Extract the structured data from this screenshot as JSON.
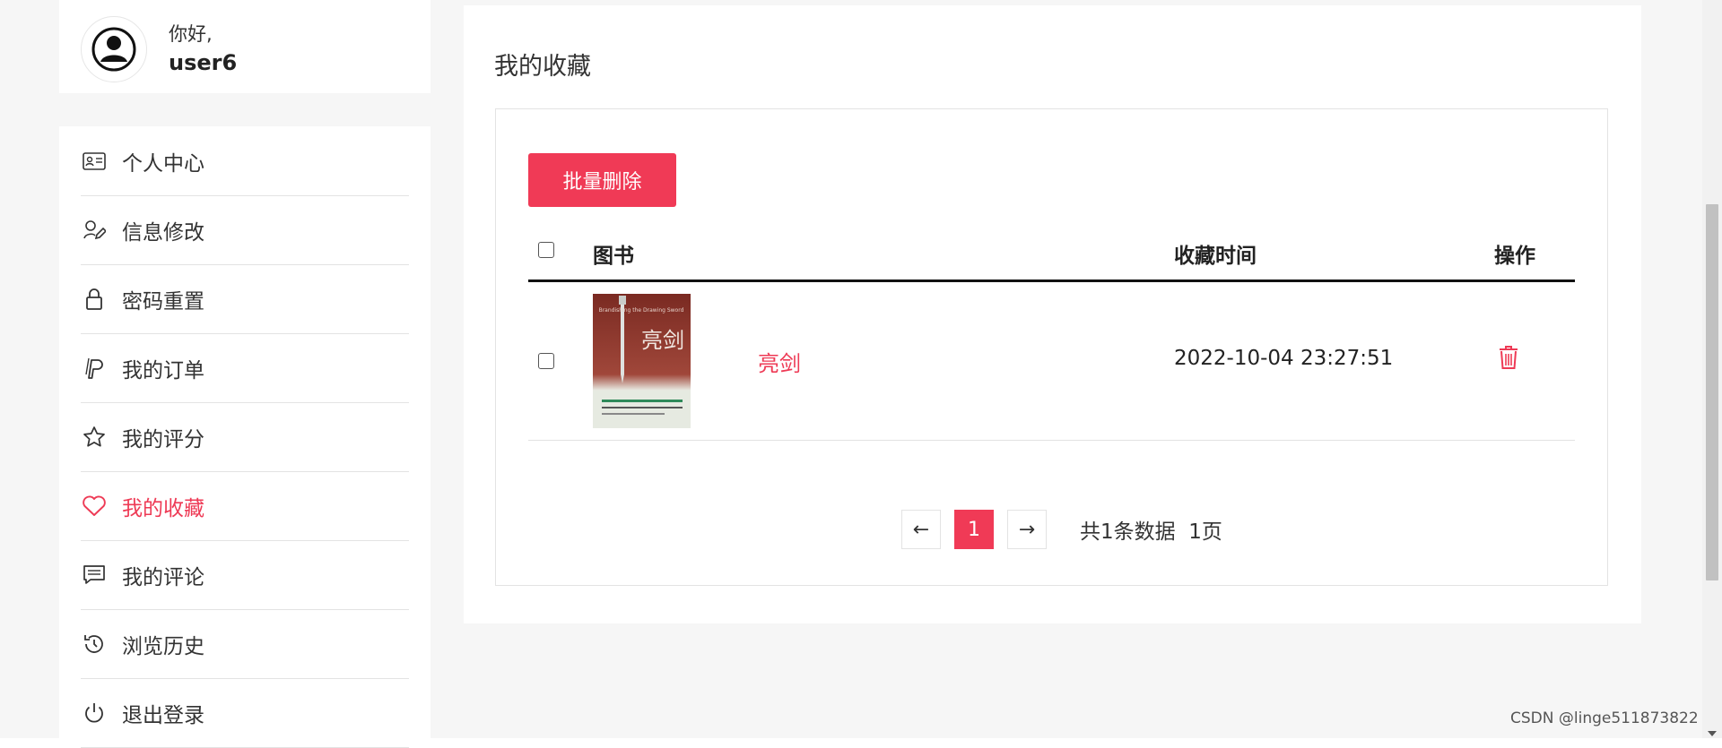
{
  "user": {
    "greeting": "你好,",
    "name": "user6"
  },
  "sidebar": {
    "items": [
      {
        "label": "个人中心",
        "icon": "id-card-icon",
        "active": false
      },
      {
        "label": "信息修改",
        "icon": "user-edit-icon",
        "active": false
      },
      {
        "label": "密码重置",
        "icon": "lock-icon",
        "active": false
      },
      {
        "label": "我的订单",
        "icon": "paypal-icon",
        "active": false
      },
      {
        "label": "我的评分",
        "icon": "star-icon",
        "active": false
      },
      {
        "label": "我的收藏",
        "icon": "heart-icon",
        "active": true
      },
      {
        "label": "我的评论",
        "icon": "comment-icon",
        "active": false
      },
      {
        "label": "浏览历史",
        "icon": "history-icon",
        "active": false
      },
      {
        "label": "退出登录",
        "icon": "power-icon",
        "active": false
      }
    ]
  },
  "main": {
    "title": "我的收藏",
    "batch_delete_label": "批量删除",
    "columns": {
      "book": "图书",
      "time": "收藏时间",
      "action": "操作"
    },
    "rows": [
      {
        "title": "亮剑",
        "time": "2022-10-04 23:27:51",
        "cover_text": "亮剑",
        "cover_subtitle": "Brandishing the Drawing Sword"
      }
    ],
    "pagination": {
      "prev": "←",
      "current": "1",
      "next": "→",
      "info": "共1条数据  1页"
    }
  },
  "watermark": "CSDN @linge511873822",
  "colors": {
    "accent": "#f03a56",
    "text": "#222222",
    "border": "#e3e3e3",
    "background": "#f6f6f6"
  }
}
